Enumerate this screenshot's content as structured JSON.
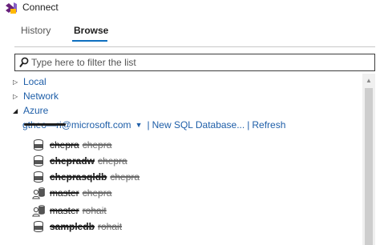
{
  "window": {
    "title": "Connect"
  },
  "tabs": [
    {
      "label": "History",
      "active": false
    },
    {
      "label": "Browse",
      "active": true
    }
  ],
  "filter": {
    "placeholder": "Type here to filter the list",
    "value": ""
  },
  "tree": {
    "local": "Local",
    "network": "Network",
    "azure": "Azure"
  },
  "account": {
    "email": "gtheo—ri@microsoft.com",
    "new_db_label": "New SQL Database...",
    "refresh_label": "Refresh"
  },
  "databases": [
    {
      "name": "chepra",
      "owner": "chepra",
      "icon": "database-icon"
    },
    {
      "name": "chepradw",
      "owner": "chepra",
      "icon": "database-icon"
    },
    {
      "name": "cheprasqldb",
      "owner": "chepra",
      "icon": "database-icon"
    },
    {
      "name": "master",
      "owner": "chepra",
      "icon": "database-user-icon"
    },
    {
      "name": "master",
      "owner": "rohait",
      "icon": "database-user-icon"
    },
    {
      "name": "sampledb",
      "owner": "rohait",
      "icon": "database-icon"
    }
  ],
  "colors": {
    "accent": "#0e70c0",
    "link": "#1e5ea8"
  }
}
